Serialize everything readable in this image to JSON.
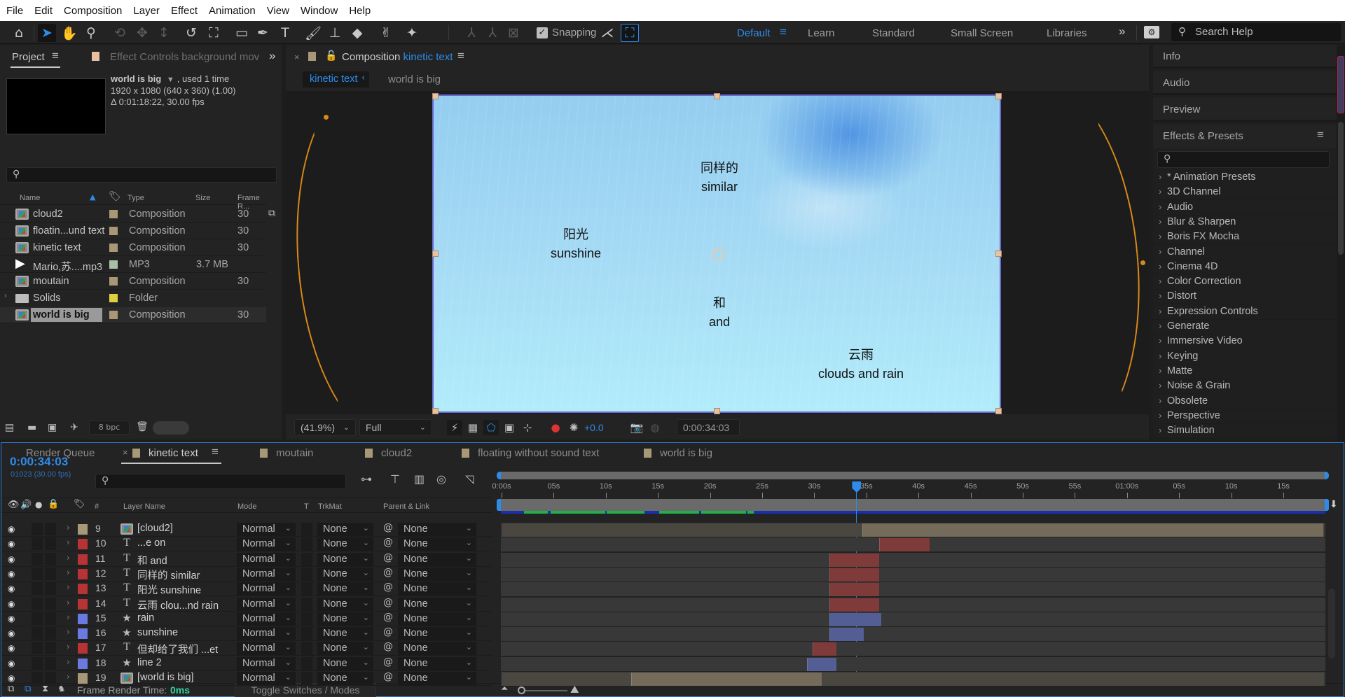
{
  "menu": [
    "File",
    "Edit",
    "Composition",
    "Layer",
    "Effect",
    "Animation",
    "View",
    "Window",
    "Help"
  ],
  "toolbar": {
    "snapping_label": "Snapping",
    "snapping_checked": true,
    "workspaces": [
      "Default",
      "Learn",
      "Standard",
      "Small Screen",
      "Libraries"
    ],
    "active_workspace": "Default",
    "search_help_placeholder": "Search Help"
  },
  "project_panel": {
    "tab_label": "Project",
    "effect_controls_tab": "Effect Controls background mov",
    "selected_item": {
      "name": "world is big",
      "usage": ", used 1 time",
      "dimensions": "1920 x 1080  (640 x 360) (1.00)",
      "duration": "Δ 0:01:18:22, 30.00 fps"
    },
    "columns": [
      "Name",
      "Type",
      "Size",
      "Frame R..."
    ],
    "items": [
      {
        "name": "cloud2",
        "type": "Composition",
        "size": "",
        "frame_rate": "30",
        "label_color": "#a89878",
        "icon": "composition-icon"
      },
      {
        "name": "floatin...und text",
        "type": "Composition",
        "size": "",
        "frame_rate": "30",
        "label_color": "#a89878",
        "icon": "composition-icon"
      },
      {
        "name": "kinetic text",
        "type": "Composition",
        "size": "",
        "frame_rate": "30",
        "label_color": "#a89878",
        "icon": "composition-icon"
      },
      {
        "name": "Mario,苏....mp3",
        "type": "MP3",
        "size": "3.7 MB",
        "frame_rate": "",
        "label_color": "#a8c0a8",
        "icon": "audio-file-icon"
      },
      {
        "name": "moutain",
        "type": "Composition",
        "size": "",
        "frame_rate": "30",
        "label_color": "#a89878",
        "icon": "composition-icon"
      },
      {
        "name": "Solids",
        "type": "Folder",
        "size": "",
        "frame_rate": "",
        "label_color": "#e0d040",
        "icon": "folder-icon"
      },
      {
        "name": "world is big",
        "type": "Composition",
        "size": "",
        "frame_rate": "30",
        "label_color": "#a89878",
        "icon": "composition-icon",
        "selected": true
      }
    ],
    "bit_depth": "8 bpc"
  },
  "composition_panel": {
    "tab_prefix": "Composition",
    "tab_comp": "kinetic text",
    "breadcrumbs": [
      "kinetic text",
      "world is big"
    ],
    "canvas_texts": [
      {
        "cn": "同样的",
        "en": "similar"
      },
      {
        "cn": "阳光",
        "en": "sunshine"
      },
      {
        "cn": "和",
        "en": "and"
      },
      {
        "cn": "云雨",
        "en": "clouds and rain"
      }
    ],
    "zoom_level": "(41.9%)",
    "resolution": "Full",
    "exposure": "+0.0",
    "current_time": "0:00:34:03"
  },
  "right_panel": {
    "sections": [
      "Info",
      "Audio",
      "Preview",
      "Effects & Presets"
    ],
    "effects": [
      "* Animation Presets",
      "3D Channel",
      "Audio",
      "Blur & Sharpen",
      "Boris FX Mocha",
      "Channel",
      "Cinema 4D",
      "Color Correction",
      "Distort",
      "Expression Controls",
      "Generate",
      "Immersive Video",
      "Keying",
      "Matte",
      "Noise & Grain",
      "Obsolete",
      "Perspective",
      "Simulation"
    ]
  },
  "timeline": {
    "tabs": [
      {
        "label": "Render Queue",
        "swatch": null
      },
      {
        "label": "kinetic text",
        "swatch": "#a89878",
        "active": true
      },
      {
        "label": "moutain",
        "swatch": "#a89878"
      },
      {
        "label": "cloud2",
        "swatch": "#a89878"
      },
      {
        "label": "floating without sound text",
        "swatch": "#a89878"
      },
      {
        "label": "world is big",
        "swatch": "#a89878"
      }
    ],
    "current_time": "0:00:34:03",
    "current_frame": "01023 (30.00 fps)",
    "current_time_seconds": 34.1,
    "columns": {
      "number": "#",
      "layer_name": "Layer Name",
      "mode": "Mode",
      "t": "T",
      "trkmat": "TrkMat",
      "parent": "Parent & Link"
    },
    "ruler_ticks": [
      "0:00s",
      "05s",
      "10s",
      "15s",
      "20s",
      "25s",
      "30s",
      "35s",
      "40s",
      "45s",
      "50s",
      "55s",
      "01:00s",
      "05s",
      "10s",
      "15s"
    ],
    "layers": [
      {
        "num": "9",
        "type": "comp",
        "name": "[cloud2]",
        "label_color": "#a89878",
        "mode": "Normal",
        "trkmat": "None",
        "parent": "None",
        "in": 34.7,
        "out": 78.9,
        "pre": 0,
        "post": 0,
        "bar_color": "#756b5a"
      },
      {
        "num": "10",
        "type": "text",
        "name": "...e on",
        "label_color": "#b83434",
        "mode": "Normal",
        "trkmat": "None",
        "parent": "None",
        "in": 36.3,
        "out": 41.1,
        "bar_color": "#7f3a3a"
      },
      {
        "num": "11",
        "type": "text",
        "name": "和 and",
        "label_color": "#b83434",
        "mode": "Normal",
        "trkmat": "None",
        "parent": "None",
        "in": 31.5,
        "out": 36.3,
        "bar_color": "#7f3a3a"
      },
      {
        "num": "12",
        "type": "text",
        "name": "同样的 similar",
        "label_color": "#b83434",
        "mode": "Normal",
        "trkmat": "None",
        "parent": "None",
        "in": 31.5,
        "out": 36.3,
        "bar_color": "#7f3a3a"
      },
      {
        "num": "13",
        "type": "text",
        "name": "阳光 sunshine",
        "label_color": "#b83434",
        "mode": "Normal",
        "trkmat": "None",
        "parent": "None",
        "in": 31.5,
        "out": 36.3,
        "bar_color": "#7f3a3a"
      },
      {
        "num": "14",
        "type": "text",
        "name": "云雨 clou...nd rain",
        "label_color": "#b83434",
        "mode": "Normal",
        "trkmat": "None",
        "parent": "None",
        "in": 31.5,
        "out": 36.3,
        "bar_color": "#7f3a3a"
      },
      {
        "num": "15",
        "type": "shape",
        "name": "rain",
        "label_color": "#6a7ae0",
        "mode": "Normal",
        "trkmat": "None",
        "parent": "None",
        "in": 31.5,
        "out": 36.5,
        "bar_color": "#535e95"
      },
      {
        "num": "16",
        "type": "shape",
        "name": "sunshine",
        "label_color": "#6a7ae0",
        "mode": "Normal",
        "trkmat": "None",
        "parent": "None",
        "in": 31.5,
        "out": 34.8,
        "bar_color": "#535e95"
      },
      {
        "num": "17",
        "type": "text",
        "name": "但却给了我们 ...et",
        "label_color": "#b83434",
        "mode": "Normal",
        "trkmat": "None",
        "parent": "None",
        "in": 29.9,
        "out": 32.2,
        "bar_color": "#7f3a3a"
      },
      {
        "num": "18",
        "type": "shape",
        "name": "line 2",
        "label_color": "#6a7ae0",
        "mode": "Normal",
        "trkmat": "None",
        "parent": "None",
        "in": 29.4,
        "out": 32.2,
        "bar_color": "#535e95"
      },
      {
        "num": "19",
        "type": "comp",
        "name": "[world is big]",
        "label_color": "#a89878",
        "mode": "Normal",
        "trkmat": "None",
        "parent": "None",
        "in": 12.5,
        "out": 30.8,
        "bar_color": "#756b5a"
      }
    ],
    "footer": {
      "frame_render_label": "Frame Render Time:",
      "frame_render_value": "0ms",
      "toggle_label": "Toggle Switches / Modes"
    }
  }
}
